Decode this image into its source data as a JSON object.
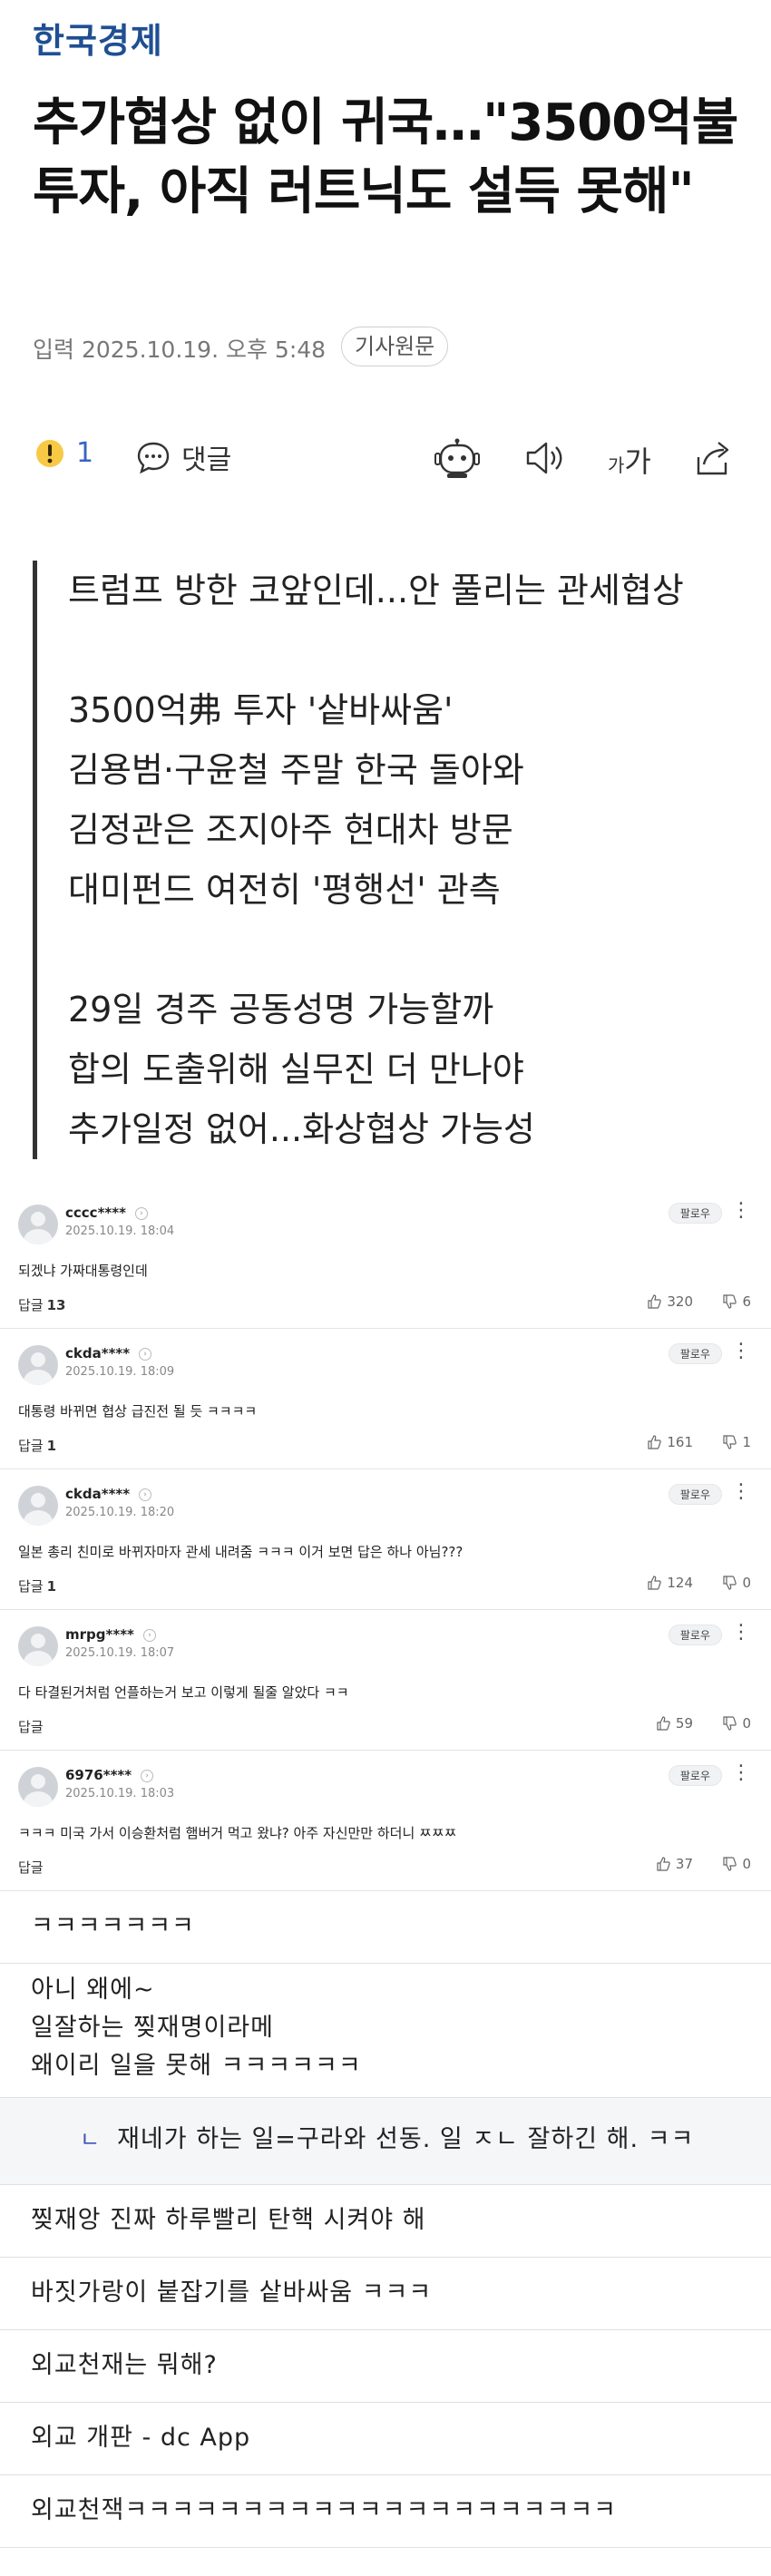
{
  "brand": {
    "logo": "한국경제"
  },
  "article": {
    "headline": "추가협상 없이 귀국…\"3500억불 투자, 아직 러트닉도 설득 못해\"",
    "dateline": "입력 2025.10.19. 오후 5:48",
    "original_button": "기사원문"
  },
  "actions": {
    "reaction_icon": "exclaim-emoji-icon",
    "reaction_count": "1",
    "comment_label": "댓글",
    "font_small": "가",
    "font_big": "가",
    "icons": [
      "robot-icon",
      "speaker-icon",
      "font-size-icon",
      "share-icon"
    ]
  },
  "summary": [
    "트럼프 방한 코앞인데...안 풀리는 관세협상",
    "",
    "3500억弗 투자 '샅바싸움'",
    "김용범·구윤철 주말 한국 돌아와",
    "김정관은 조지아주 현대차 방문",
    "대미펀드 여전히 '평행선' 관측",
    "",
    "29일 경주 공동성명 가능할까",
    "합의 도출위해 실무진 더 만나야",
    "추가일정 없어...화상협상 가능성"
  ],
  "comments": [
    {
      "user": "cccc****",
      "time": "2025.10.19. 18:04",
      "text": "되겠냐 가짜대통령인데",
      "reply_label": "답글",
      "reply_count": "13",
      "likes": "320",
      "dislikes": "6",
      "follow": "팔로우"
    },
    {
      "user": "ckda****",
      "time": "2025.10.19. 18:09",
      "text": "대통령 바뀌면 협상 급진전 될 듯 ㅋㅋㅋㅋ",
      "reply_label": "답글",
      "reply_count": "1",
      "likes": "161",
      "dislikes": "1",
      "follow": "팔로우"
    },
    {
      "user": "ckda****",
      "time": "2025.10.19. 18:20",
      "text": "일본 총리 친미로 바뀌자마자 관세 내려줌 ㅋㅋㅋ 이거 보면 답은 하나 아님???",
      "reply_label": "답글",
      "reply_count": "1",
      "likes": "124",
      "dislikes": "0",
      "follow": "팔로우"
    },
    {
      "user": "mrpg****",
      "time": "2025.10.19. 18:07",
      "text": "다 타결된거처럼 언플하는거 보고 이렇게 될줄 알았다 ㅋㅋ",
      "reply_label": "답글",
      "reply_count": "",
      "likes": "59",
      "dislikes": "0",
      "follow": "팔로우"
    },
    {
      "user": "6976****",
      "time": "2025.10.19. 18:03",
      "text": "ㅋㅋㅋ 미국 가서 이승환처럼 햄버거 먹고 왔냐? 아주 자신만만 하더니 ㅉㅉㅉ",
      "reply_label": "답글",
      "reply_count": "",
      "likes": "37",
      "dislikes": "0",
      "follow": "팔로우"
    }
  ],
  "posts": [
    {
      "type": "single",
      "lines": [
        "ㅋㅋㅋㅋㅋㅋㅋ"
      ]
    },
    {
      "type": "multi",
      "lines": [
        "아니 왜에~",
        "일잘하는 찢재명이라메",
        "왜이리 일을 못해 ㅋㅋㅋㅋㅋㅋ"
      ]
    },
    {
      "type": "reply",
      "mark": "ㄴ",
      "lines": [
        "재네가 하는 일=구라와 선동. 일 ㅈㄴ 잘하긴 해. ㅋㅋ"
      ]
    },
    {
      "type": "single",
      "lines": [
        "찢재앙 진짜 하루빨리 탄핵 시켜야 해"
      ]
    },
    {
      "type": "single",
      "lines": [
        "바짓가랑이 붙잡기를 샅바싸움 ㅋㅋㅋ"
      ]
    },
    {
      "type": "single",
      "lines": [
        "외교천재는 뭐해?"
      ]
    },
    {
      "type": "single",
      "lines": [
        "외교 개판 - dc App"
      ]
    },
    {
      "type": "single",
      "lines": [
        "외교천잭ㅋㅋㅋㅋㅋㅋㅋㅋㅋㅋㅋㅋㅋㅋㅋㅋㅋㅋㅋㅋㅋ"
      ]
    }
  ]
}
